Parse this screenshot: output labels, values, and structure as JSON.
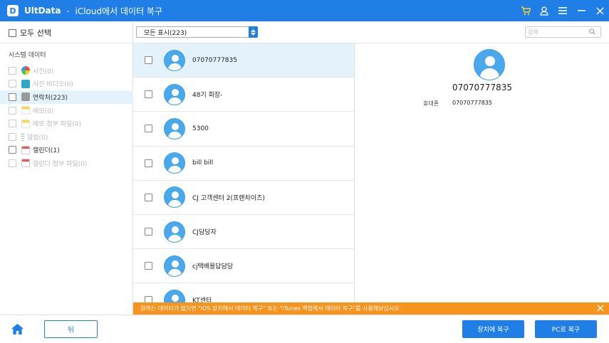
{
  "titlebar": {
    "brand": "UltData",
    "separator": "-",
    "title": "iCloud에서 데이터 복구",
    "icons": [
      "cart-icon",
      "user-icon",
      "menu-icon",
      "minimize-icon",
      "close-icon"
    ]
  },
  "left": {
    "select_all": "모두 선택",
    "section_title": "시스템 데이터",
    "categories": [
      {
        "label": "사진(0)",
        "icon": "photos-icon",
        "disabled": true
      },
      {
        "label": "사진 비디오(0)",
        "icon": "video-icon",
        "disabled": true
      },
      {
        "label": "연락처(223)",
        "icon": "contacts-icon",
        "disabled": false,
        "active": true
      },
      {
        "label": "메모(0)",
        "icon": "notes-icon",
        "disabled": true
      },
      {
        "label": "메모 첨부 파일(0)",
        "icon": "notes-attachment-icon",
        "disabled": true
      },
      {
        "label": "알림(0)",
        "icon": "reminders-icon",
        "disabled": true
      },
      {
        "label": "캘린더(1)",
        "icon": "calendar-icon",
        "disabled": false
      },
      {
        "label": "캘린더 첨부 파일(0)",
        "icon": "calendar-attachment-icon",
        "disabled": true
      }
    ]
  },
  "filter": {
    "selected": "모든 표시(223)",
    "search_placeholder": "검색"
  },
  "contacts": [
    {
      "name": "07070777835",
      "selected": true
    },
    {
      "name": "48기 회장-"
    },
    {
      "name": "5300"
    },
    {
      "name": "bill bill"
    },
    {
      "name": "CJ 고객센터  2(프랜차이즈)"
    },
    {
      "name": "CJ담당자"
    },
    {
      "name": "cj택배용답담당"
    },
    {
      "name": "KT센터"
    }
  ],
  "detail": {
    "name": "07070777835",
    "phone_label": "휴대폰",
    "phone": "07070777835"
  },
  "notice": {
    "text": "원하는 데이터가 없으면 \"iOS 장치에서 데이터 복구\" 또는 \"iTunes 백업에서 데이터 복구\"를 사용해보십시오."
  },
  "bottom": {
    "back_label": "뒤",
    "device_label": "장치에 복구",
    "pc_label": "PC로 복구"
  },
  "colors": {
    "accent": "#1f7fe6",
    "notice": "#f7941d",
    "selected_row": "#e4f2fc"
  }
}
